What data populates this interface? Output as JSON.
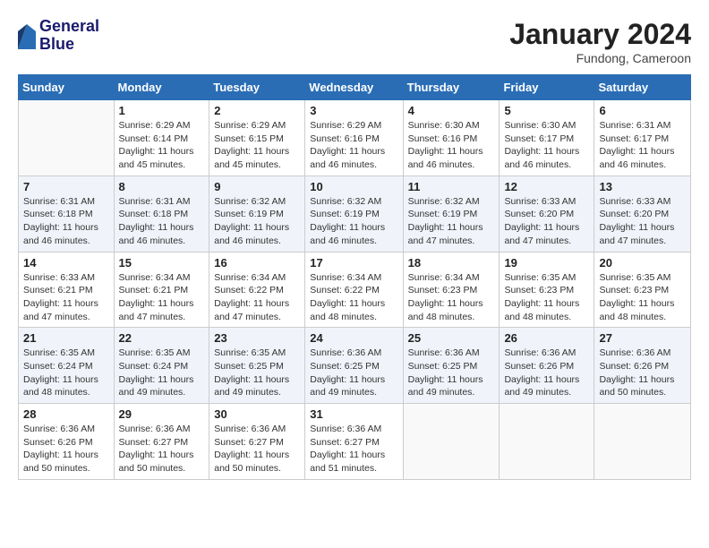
{
  "header": {
    "logo_line1": "General",
    "logo_line2": "Blue",
    "month_title": "January 2024",
    "location": "Fundong, Cameroon"
  },
  "weekdays": [
    "Sunday",
    "Monday",
    "Tuesday",
    "Wednesday",
    "Thursday",
    "Friday",
    "Saturday"
  ],
  "weeks": [
    [
      {
        "day": "",
        "info": ""
      },
      {
        "day": "1",
        "info": "Sunrise: 6:29 AM\nSunset: 6:14 PM\nDaylight: 11 hours\nand 45 minutes."
      },
      {
        "day": "2",
        "info": "Sunrise: 6:29 AM\nSunset: 6:15 PM\nDaylight: 11 hours\nand 45 minutes."
      },
      {
        "day": "3",
        "info": "Sunrise: 6:29 AM\nSunset: 6:16 PM\nDaylight: 11 hours\nand 46 minutes."
      },
      {
        "day": "4",
        "info": "Sunrise: 6:30 AM\nSunset: 6:16 PM\nDaylight: 11 hours\nand 46 minutes."
      },
      {
        "day": "5",
        "info": "Sunrise: 6:30 AM\nSunset: 6:17 PM\nDaylight: 11 hours\nand 46 minutes."
      },
      {
        "day": "6",
        "info": "Sunrise: 6:31 AM\nSunset: 6:17 PM\nDaylight: 11 hours\nand 46 minutes."
      }
    ],
    [
      {
        "day": "7",
        "info": "Sunrise: 6:31 AM\nSunset: 6:18 PM\nDaylight: 11 hours\nand 46 minutes."
      },
      {
        "day": "8",
        "info": "Sunrise: 6:31 AM\nSunset: 6:18 PM\nDaylight: 11 hours\nand 46 minutes."
      },
      {
        "day": "9",
        "info": "Sunrise: 6:32 AM\nSunset: 6:19 PM\nDaylight: 11 hours\nand 46 minutes."
      },
      {
        "day": "10",
        "info": "Sunrise: 6:32 AM\nSunset: 6:19 PM\nDaylight: 11 hours\nand 46 minutes."
      },
      {
        "day": "11",
        "info": "Sunrise: 6:32 AM\nSunset: 6:19 PM\nDaylight: 11 hours\nand 47 minutes."
      },
      {
        "day": "12",
        "info": "Sunrise: 6:33 AM\nSunset: 6:20 PM\nDaylight: 11 hours\nand 47 minutes."
      },
      {
        "day": "13",
        "info": "Sunrise: 6:33 AM\nSunset: 6:20 PM\nDaylight: 11 hours\nand 47 minutes."
      }
    ],
    [
      {
        "day": "14",
        "info": "Sunrise: 6:33 AM\nSunset: 6:21 PM\nDaylight: 11 hours\nand 47 minutes."
      },
      {
        "day": "15",
        "info": "Sunrise: 6:34 AM\nSunset: 6:21 PM\nDaylight: 11 hours\nand 47 minutes."
      },
      {
        "day": "16",
        "info": "Sunrise: 6:34 AM\nSunset: 6:22 PM\nDaylight: 11 hours\nand 47 minutes."
      },
      {
        "day": "17",
        "info": "Sunrise: 6:34 AM\nSunset: 6:22 PM\nDaylight: 11 hours\nand 48 minutes."
      },
      {
        "day": "18",
        "info": "Sunrise: 6:34 AM\nSunset: 6:23 PM\nDaylight: 11 hours\nand 48 minutes."
      },
      {
        "day": "19",
        "info": "Sunrise: 6:35 AM\nSunset: 6:23 PM\nDaylight: 11 hours\nand 48 minutes."
      },
      {
        "day": "20",
        "info": "Sunrise: 6:35 AM\nSunset: 6:23 PM\nDaylight: 11 hours\nand 48 minutes."
      }
    ],
    [
      {
        "day": "21",
        "info": "Sunrise: 6:35 AM\nSunset: 6:24 PM\nDaylight: 11 hours\nand 48 minutes."
      },
      {
        "day": "22",
        "info": "Sunrise: 6:35 AM\nSunset: 6:24 PM\nDaylight: 11 hours\nand 49 minutes."
      },
      {
        "day": "23",
        "info": "Sunrise: 6:35 AM\nSunset: 6:25 PM\nDaylight: 11 hours\nand 49 minutes."
      },
      {
        "day": "24",
        "info": "Sunrise: 6:36 AM\nSunset: 6:25 PM\nDaylight: 11 hours\nand 49 minutes."
      },
      {
        "day": "25",
        "info": "Sunrise: 6:36 AM\nSunset: 6:25 PM\nDaylight: 11 hours\nand 49 minutes."
      },
      {
        "day": "26",
        "info": "Sunrise: 6:36 AM\nSunset: 6:26 PM\nDaylight: 11 hours\nand 49 minutes."
      },
      {
        "day": "27",
        "info": "Sunrise: 6:36 AM\nSunset: 6:26 PM\nDaylight: 11 hours\nand 50 minutes."
      }
    ],
    [
      {
        "day": "28",
        "info": "Sunrise: 6:36 AM\nSunset: 6:26 PM\nDaylight: 11 hours\nand 50 minutes."
      },
      {
        "day": "29",
        "info": "Sunrise: 6:36 AM\nSunset: 6:27 PM\nDaylight: 11 hours\nand 50 minutes."
      },
      {
        "day": "30",
        "info": "Sunrise: 6:36 AM\nSunset: 6:27 PM\nDaylight: 11 hours\nand 50 minutes."
      },
      {
        "day": "31",
        "info": "Sunrise: 6:36 AM\nSunset: 6:27 PM\nDaylight: 11 hours\nand 51 minutes."
      },
      {
        "day": "",
        "info": ""
      },
      {
        "day": "",
        "info": ""
      },
      {
        "day": "",
        "info": ""
      }
    ]
  ]
}
